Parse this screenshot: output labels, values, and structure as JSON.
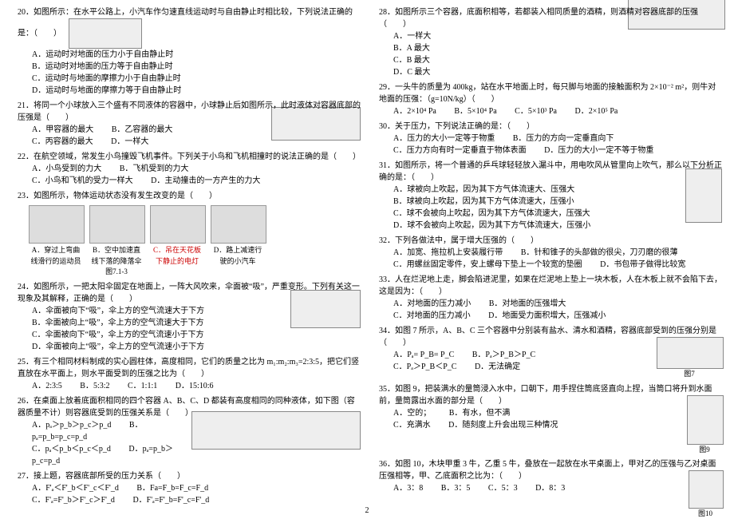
{
  "page_number": "2",
  "left": {
    "q20": {
      "stem": "20．如图所示：在水平公路上，小汽车作匀速直线运动时与自由静止时相比较，下列说法正确的是：（　　）",
      "A": "A．运动时对地面的压力小于自由静止时",
      "B": "B．运动时对地面的压力等于自由静止时",
      "C": "C．运动时与地面的摩擦力小于自由静止时",
      "D": "D．运动时与地面的摩擦力等于自由静止时"
    },
    "q21": {
      "stem": "21．将同一个小球放入三个盛有不同液体的容器中，小球静止后如图所示，此时液体对容器底部的压强是（　　）",
      "A": "A．甲容器的最大",
      "B": "B．乙容器的最大",
      "C": "C．丙容器的最大",
      "D": "D．一样大"
    },
    "q22": {
      "stem": "22．在航空领域，常发生小鸟撞毁飞机事件。下列关于小鸟和飞机相撞时的说法正确的是（　　）",
      "A": "A．小鸟受到的力大",
      "B": "B．飞机受到的力大",
      "C": "C．小鸟和飞机的受力一样大",
      "D": "D．主动撞击的一方产生的力大"
    },
    "q23": {
      "stem": "23．如图所示，物体运动状态没有发生改变的是（　　）",
      "imgA": "A．穿过上弯曲线滑行的运动员",
      "imgB": "B．空中加速直线下落的降落伞",
      "imgB_extra": "图7.1-3",
      "imgC": "C．吊在天花板下静止的电灯",
      "imgD": "D．路上减速行驶的小汽车"
    },
    "q24": {
      "stem": "24．如图所示，一把太阳伞固定在地面上，一阵大风吹来，伞面被“吸”，严重变形。下列有关这一现象及其解释，正确的是（　　）",
      "A": "A．伞面被向下“吸”，伞上方的空气流速大于下方",
      "B": "B．伞面被向上“吸”，伞上方的空气流速大于下方",
      "C": "C．伞面被向下“吸”，伞上方的空气流速小于下方",
      "D": "D．伞面被向上“吸”，伞上方的空气流速小于下方"
    },
    "q25": {
      "stem": "25．有三个相同材料制成的实心圆柱体，高度相同，它们的质量之比为 m₁:m₂:m₃=2:3:5，把它们竖直放在水平面上，则水平面受到的压强之比为（　　）",
      "A": "A．2:3:5",
      "B": "B．5:3:2",
      "C": "C．1:1:1",
      "D": "D．15:10:6"
    },
    "q26": {
      "stem": "26．在桌面上放着底面积相同的四个容器 A、B、C、D 都装有高度相同的同种液体，如下图（容器质量不计）则容器底受到的压强关系是（　　）",
      "A": "A．pₐ＞p_b＞p_c＞p_d",
      "B": "B．pₐ=p_b=p_c=p_d",
      "C": "C．pₐ＜p_b＜p_c＜p_d",
      "D": "D．pₐ=p_b＞p_c=p_d"
    },
    "q27": {
      "stem": "27．接上题，容器底部所受的压力关系（　　）",
      "A": "A．F'ₐ＜F'_b＜F'_c＜F'_d",
      "B": "B．Fa=F_b=F_c=F_d",
      "C": "C．F'ₐ=F'_b＞F'_c＞F'_d",
      "D": "D．F'ₐ=F'_b=F'_c=F'_d"
    }
  },
  "right": {
    "q28": {
      "stem": "28．如图所示三个容器，底面积相等，若都装入相同质量的酒精，则酒精对容器底部的压强（　　）",
      "A": "A．一样大",
      "B": "B．A 最大",
      "C": "C．B 最大",
      "D": "D．C 最大"
    },
    "q29": {
      "stem": "29．一头牛的质量为 400kg，站在水平地面上时，每只脚与地面的接触面积为 2×10⁻² m²，则牛对地面的压强：（g=10N/kg）（　　）",
      "A": "A．2×10⁴ Pa",
      "B": "B．5×10⁴ Pa",
      "C": "C．5×10³ Pa",
      "D": "D．2×10⁵ Pa"
    },
    "q30": {
      "stem": "30．关于压力，下列说法正确的是：（　　）",
      "A": "A．压力的大小一定等于物重",
      "B": "B．压力的方向一定垂直向下",
      "C": "C．压力方向有时一定垂直于物体表面",
      "D": "D．压力的大小一定不等于物重"
    },
    "q31": {
      "stem": "31．如图所示，将一个普通的乒乓球轻轻放入漏斗中，用电吹风从管里向上吹气，那么以下分析正确的是：（　　）",
      "A": "A．球被向上吹起，因为其下方气体流速大、压强大",
      "B": "B．球被向上吹起，因为其下方气体流速大，压强小",
      "C": "C．球不会被向上吹起，因为其下方气体流速大，压强大",
      "D": "D．球不会被向上吹起，因为其下方气体流速大，压强小"
    },
    "q32": {
      "stem": "32．下列各做法中，属于增大压强的（　　）",
      "A": "A．加宽、拖拉机上安装履行带",
      "B": "B．针和锥子的头部做的很尖，刀刃磨的很薄",
      "C": "C．用螺丝固定零件，安上螺母下垫上一个较宽的垫圈",
      "D": "D．书包带子做得比较宽"
    },
    "q33": {
      "stem": "33．人在烂泥地上走，脚会陷进泥里，如果在烂泥地上垫上一块木板，人在木板上就不会陷下去，这是因为：（　　）",
      "A": "A．对地面的压力减小",
      "B": "B．对地面的压强增大",
      "C": "C．对地面的压力减小",
      "D": "D．地面受力面积增大，压强减小"
    },
    "q34": {
      "stem": "34．如图 7 所示，A、B、C 三个容器中分别装有盐水、清水和酒精，容器底部受到的压强分别是（　　）",
      "fig": "图7",
      "A": "A．Pₐ= P_B= P_C",
      "B": "B．Pₐ＞P_B＞P_C",
      "C": "C．Pₐ＞P_B＜P_C",
      "D": "D．无法确定"
    },
    "q35": {
      "stem": "35．如图 9，把装满水的量筒浸入水中，口朝下，用手捏住筒底竖直向上捏，当筒口将升到水面前，量筒露出水面的部分是（　　）",
      "fig": "图9",
      "A": "A．空的；",
      "B": "B．有水，但不满",
      "C": "C．充满水",
      "D": "D．随刻度上升会出现三种情况"
    },
    "q36": {
      "stem": "36．如图 10，木块甲重 3 牛，乙重 5 牛，叠放在一起放在水平桌面上，甲对乙的压强与乙对桌面压强相等，甲、乙底面积之比为：（　　）",
      "fig": "图10",
      "A": "A．3：8",
      "B": "B．3：5",
      "C": "C．5：3",
      "D": "D．8：3"
    }
  }
}
